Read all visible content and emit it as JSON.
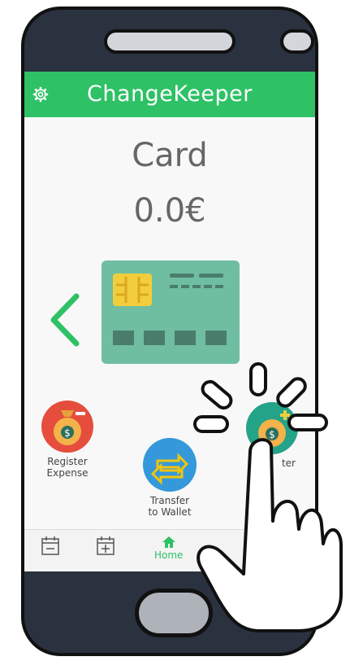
{
  "app": {
    "title": "ChangeKeeper"
  },
  "main": {
    "page_title": "Card",
    "balance": "0.0€"
  },
  "actions": {
    "register_expense": "Register\nExpense",
    "transfer": "Transfer\nto Wallet",
    "register_income_partial": "ter"
  },
  "nav": {
    "home": "Home"
  },
  "colors": {
    "accent": "#2ec166",
    "phone_body": "#2b323f",
    "card": "#6fbea1",
    "chip": "#f3ce3c",
    "expense": "#e54d3c",
    "transfer": "#3498db",
    "income": "#23a388"
  },
  "icons": [
    "gear-icon",
    "chevron-left-icon",
    "credit-card-icon",
    "money-bag-minus-icon",
    "transfer-arrows-icon",
    "money-bag-plus-icon",
    "calendar-minus-icon",
    "calendar-plus-icon",
    "home-icon",
    "pointing-hand-icon"
  ]
}
